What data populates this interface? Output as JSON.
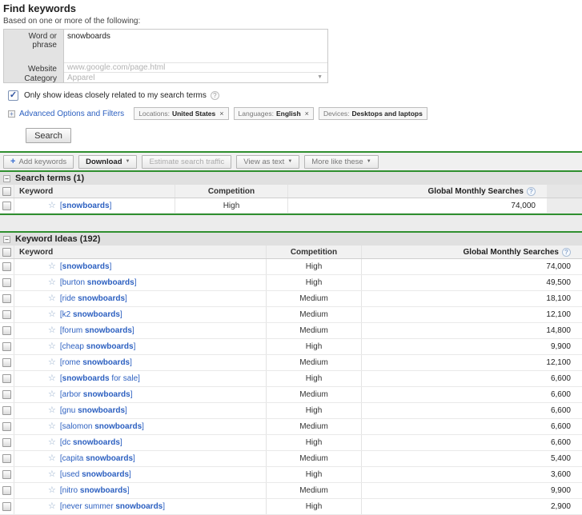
{
  "colors": {
    "accent_green": "#2f8f2f",
    "link_blue": "#2b5fc0"
  },
  "icons": {
    "help": "?",
    "star": "☆",
    "close": "×",
    "plus": "+",
    "dropdown": "▼",
    "collapse": "−",
    "expand": "+",
    "check": "✓"
  },
  "page": {
    "title": "Find keywords",
    "subtitle": "Based on one or more of the following:"
  },
  "form": {
    "word_label": "Word or phrase",
    "word_value": "snowboards",
    "website_label": "Website",
    "website_placeholder": "www.google.com/page.html",
    "category_label": "Category",
    "category_value": "Apparel"
  },
  "options": {
    "related_label": "Only show ideas closely related to my search terms",
    "related_checked": true,
    "advanced_label": "Advanced Options and Filters",
    "chips": [
      {
        "label": "Locations:",
        "value": "United States",
        "removable": true
      },
      {
        "label": "Languages:",
        "value": "English",
        "removable": true
      },
      {
        "label": "Devices:",
        "value": "Desktops and laptops",
        "removable": false
      }
    ],
    "search_button": "Search"
  },
  "toolbar": {
    "add_keywords": "Add keywords",
    "download": "Download",
    "estimate": "Estimate search traffic",
    "view_as_text": "View as text",
    "more_like_these": "More like these"
  },
  "bold_term": "snowboards",
  "search_terms": {
    "title": "Search terms (1)",
    "columns": {
      "keyword": "Keyword",
      "competition": "Competition",
      "searches": "Global Monthly Searches"
    },
    "rows": [
      {
        "keyword": "[snowboards]",
        "competition": "High",
        "searches": "74,000"
      }
    ]
  },
  "keyword_ideas": {
    "title": "Keyword Ideas (192)",
    "columns": {
      "keyword": "Keyword",
      "competition": "Competition",
      "searches": "Global Monthly Searches"
    },
    "rows": [
      {
        "keyword": "[snowboards]",
        "competition": "High",
        "searches": "74,000"
      },
      {
        "keyword": "[burton snowboards]",
        "competition": "High",
        "searches": "49,500"
      },
      {
        "keyword": "[ride snowboards]",
        "competition": "Medium",
        "searches": "18,100"
      },
      {
        "keyword": "[k2 snowboards]",
        "competition": "Medium",
        "searches": "12,100"
      },
      {
        "keyword": "[forum snowboards]",
        "competition": "Medium",
        "searches": "14,800"
      },
      {
        "keyword": "[cheap snowboards]",
        "competition": "High",
        "searches": "9,900"
      },
      {
        "keyword": "[rome snowboards]",
        "competition": "Medium",
        "searches": "12,100"
      },
      {
        "keyword": "[snowboards for sale]",
        "competition": "High",
        "searches": "6,600"
      },
      {
        "keyword": "[arbor snowboards]",
        "competition": "Medium",
        "searches": "6,600"
      },
      {
        "keyword": "[gnu snowboards]",
        "competition": "High",
        "searches": "6,600"
      },
      {
        "keyword": "[salomon snowboards]",
        "competition": "Medium",
        "searches": "6,600"
      },
      {
        "keyword": "[dc snowboards]",
        "competition": "High",
        "searches": "6,600"
      },
      {
        "keyword": "[capita snowboards]",
        "competition": "Medium",
        "searches": "5,400"
      },
      {
        "keyword": "[used snowboards]",
        "competition": "High",
        "searches": "3,600"
      },
      {
        "keyword": "[nitro snowboards]",
        "competition": "Medium",
        "searches": "9,900"
      },
      {
        "keyword": "[never summer snowboards]",
        "competition": "High",
        "searches": "2,900"
      }
    ]
  }
}
